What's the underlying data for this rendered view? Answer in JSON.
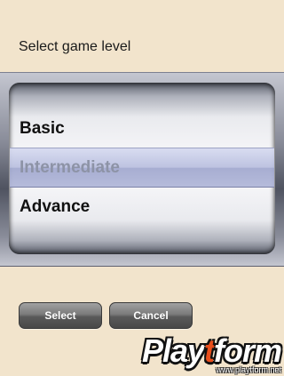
{
  "prompt": {
    "text": "Select game level"
  },
  "picker": {
    "options": [
      "Basic",
      "Intermediate",
      "Advance"
    ],
    "selected": "Intermediate"
  },
  "buttons": {
    "select_label": "Select",
    "cancel_label": "Cancel"
  },
  "watermark": {
    "logo_prefix": "Play",
    "logo_accent": "t",
    "logo_suffix": "form",
    "url": "www.playtform.net",
    "accent_color": "#e94e1b"
  }
}
